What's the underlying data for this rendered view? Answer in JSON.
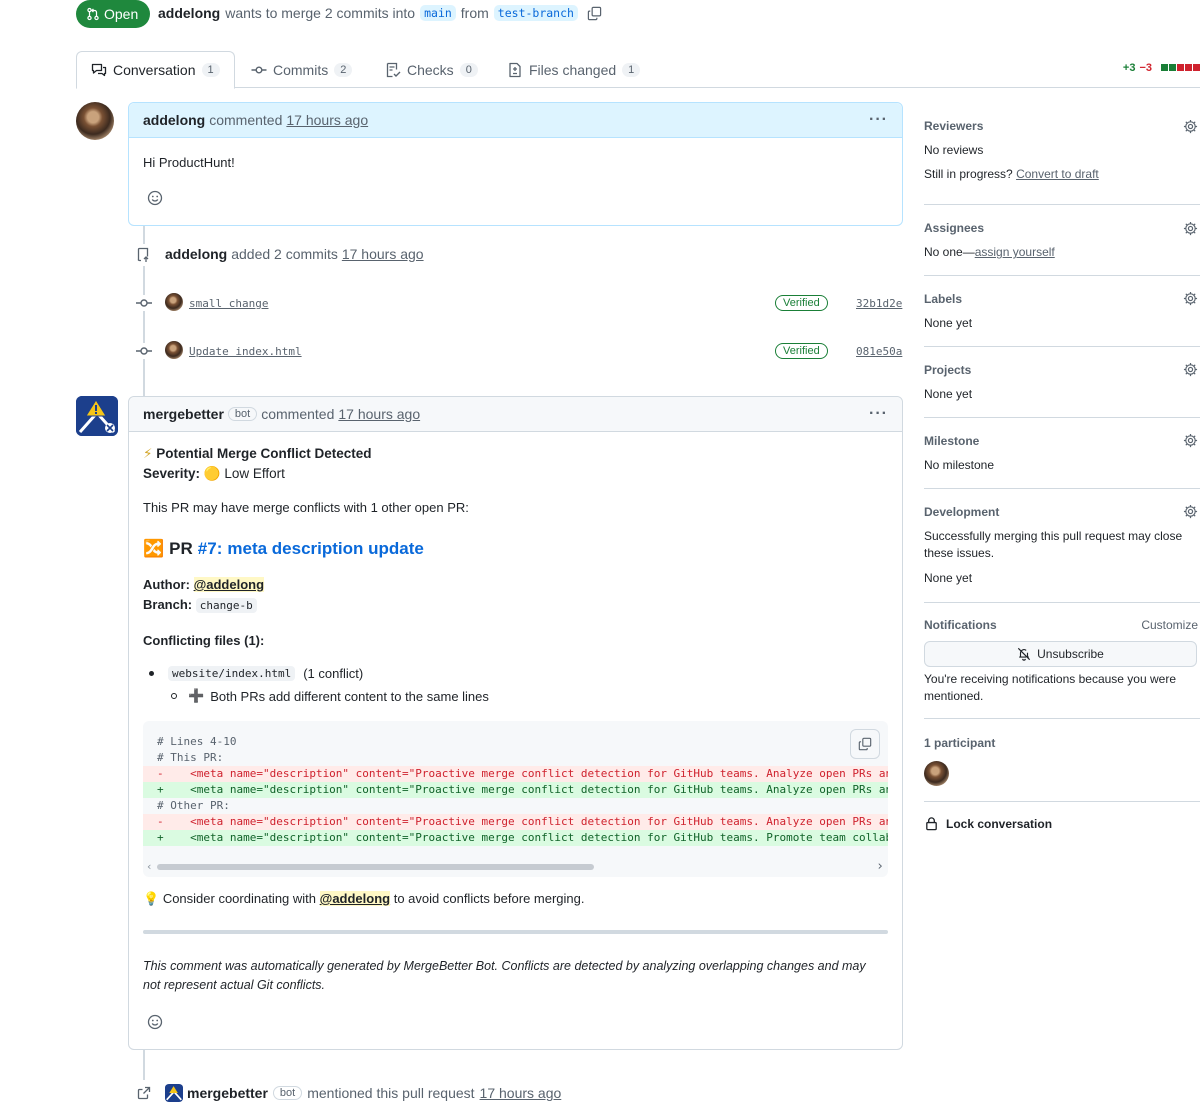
{
  "header": {
    "state": "Open",
    "author": "addelong",
    "summary_mid": "wants to merge 2 commits into",
    "base_branch": "main",
    "from_word": "from",
    "head_branch": "test-branch"
  },
  "tabs": [
    {
      "label": "Conversation",
      "count": "1",
      "active": true
    },
    {
      "label": "Commits",
      "count": "2"
    },
    {
      "label": "Checks",
      "count": "0"
    },
    {
      "label": "Files changed",
      "count": "1"
    }
  ],
  "diffstat": {
    "additions": "+3",
    "deletions": "−3"
  },
  "colors": {
    "open_green": "#1f883d",
    "accent_blue": "#0969da",
    "border": "#d1d9e0",
    "add_green": "#1a7f37",
    "del_red": "#d1242f"
  },
  "comment1": {
    "author": "addelong",
    "action": "commented",
    "time": "17 hours ago",
    "body": "Hi ProductHunt!"
  },
  "commits_event": {
    "author": "addelong",
    "action": "added 2 commits",
    "time": "17 hours ago",
    "commits": [
      {
        "message": "small change",
        "status": "Verified",
        "sha": "32b1d2e"
      },
      {
        "message": "Update index.html",
        "status": "Verified",
        "sha": "081e50a"
      }
    ]
  },
  "bot_comment": {
    "author": "mergebetter",
    "badge": "bot",
    "action": "commented",
    "time": "17 hours ago",
    "heading_icon": "⚡",
    "heading": "Potential Merge Conflict Detected",
    "severity_label": "Severity:",
    "severity_icon": "🟡",
    "severity_value": "Low Effort",
    "intro": "This PR may have merge conflicts with 1 other open PR:",
    "pr_icon": "🔀",
    "pr_prefix": "PR",
    "pr_number": "#7",
    "pr_title": "meta description update",
    "author_label": "Author:",
    "author_mention": "@addelong",
    "branch_label": "Branch:",
    "branch_value": "change-b",
    "conflicting_files_heading": "Conflicting files (1):",
    "file_name": "website/index.html",
    "file_conflicts": "(1 conflict)",
    "sub_icon": "➕",
    "sub_text": "Both PRs add different content to the same lines",
    "code_lines": [
      {
        "kind": "comment",
        "text": "# Lines 4-10"
      },
      {
        "kind": "comment",
        "text": "# This PR:"
      },
      {
        "kind": "del",
        "text": "-    <meta name=\"description\" content=\"Proactive merge conflict detection for GitHub teams. Analyze open PRs an"
      },
      {
        "kind": "add",
        "text": "+    <meta name=\"description\" content=\"Proactive merge conflict detection for GitHub teams. Analyze open PRs an"
      },
      {
        "kind": "comment",
        "text": "# Other PR:"
      },
      {
        "kind": "del",
        "text": "-    <meta name=\"description\" content=\"Proactive merge conflict detection for GitHub teams. Analyze open PRs an"
      },
      {
        "kind": "add",
        "text": "+    <meta name=\"description\" content=\"Proactive merge conflict detection for GitHub teams. Promote team collab"
      }
    ],
    "tip_icon": "💡",
    "tip_before": "Consider coordinating with",
    "tip_mention": "@addelong",
    "tip_after": "to avoid conflicts before merging.",
    "footer": "This comment was automatically generated by MergeBetter Bot. Conflicts are detected by analyzing overlapping changes and may not represent actual Git conflicts."
  },
  "mention_event": {
    "author": "mergebetter",
    "badge": "bot",
    "action": "mentioned this pull request",
    "time": "17 hours ago"
  },
  "sidebar": {
    "reviewers": {
      "title": "Reviewers",
      "value": "No reviews",
      "draft_prefix": "Still in progress?",
      "draft_link": "Convert to draft"
    },
    "assignees": {
      "title": "Assignees",
      "value_prefix": "No one—",
      "value_link": "assign yourself"
    },
    "labels": {
      "title": "Labels",
      "value": "None yet"
    },
    "projects": {
      "title": "Projects",
      "value": "None yet"
    },
    "milestone": {
      "title": "Milestone",
      "value": "No milestone"
    },
    "development": {
      "title": "Development",
      "desc": "Successfully merging this pull request may close these issues.",
      "value": "None yet"
    },
    "notifications": {
      "title": "Notifications",
      "customize": "Customize",
      "button": "Unsubscribe",
      "note": "You're receiving notifications because you were mentioned."
    },
    "participants": {
      "title": "1 participant"
    },
    "lock": {
      "label": "Lock conversation"
    }
  }
}
